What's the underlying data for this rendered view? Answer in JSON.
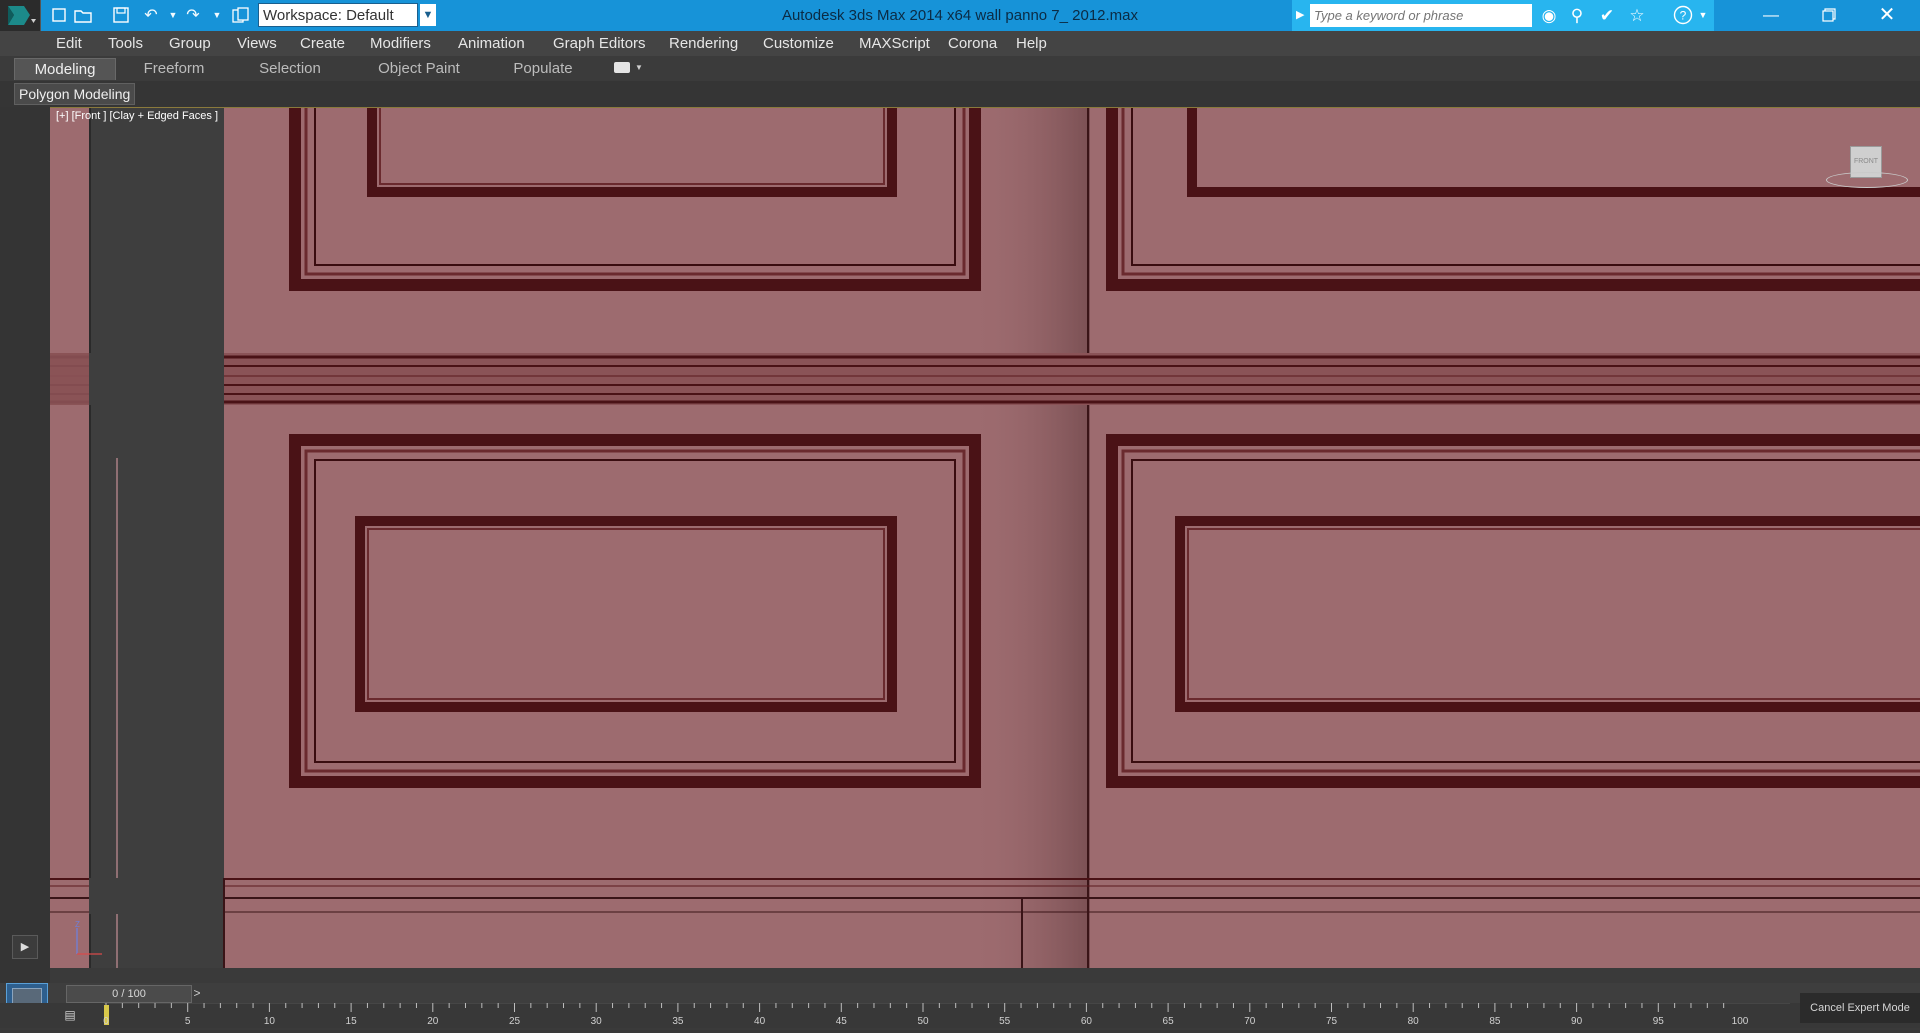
{
  "titlebar": {
    "title": "Autodesk 3ds Max  2014 x64      wall panno 7_ 2012.max",
    "workspace_label": "Workspace: Default",
    "search_placeholder": "Type a keyword or phrase",
    "background": "#1793d8"
  },
  "quick_access_icons": [
    "new-file-icon",
    "open-file-icon",
    "save-file-icon",
    "undo-icon",
    "undo-dropdown-icon",
    "redo-icon",
    "redo-dropdown-icon",
    "project-folder-icon"
  ],
  "search_tools": [
    "binoculars-icon",
    "key-icon",
    "exchange-icon",
    "star-icon",
    "help-icon"
  ],
  "window_controls": [
    "minimize-icon",
    "restore-icon",
    "close-icon"
  ],
  "menu": {
    "items": [
      "Edit",
      "Tools",
      "Group",
      "Views",
      "Create",
      "Modifiers",
      "Animation",
      "Graph Editors",
      "Rendering",
      "Customize",
      "MAXScript",
      "Corona",
      "Help"
    ]
  },
  "ribbon": {
    "tabs": [
      "Modeling",
      "Freeform",
      "Selection",
      "Object Paint",
      "Populate"
    ],
    "active_tab": "Modeling",
    "panel_label": "Polygon Modeling"
  },
  "viewport": {
    "label": "[+] [Front ] [Clay + Edged Faces ]",
    "viewcube_label": "FRONT",
    "axis_label": "Z",
    "surface_color": "#9d6b6f",
    "frame_color": "#4a1216"
  },
  "timeline": {
    "frame_counter": "0 / 100",
    "next_label": ">",
    "ticks": [
      "0",
      "5",
      "10",
      "15",
      "20",
      "25",
      "30",
      "35",
      "40",
      "45",
      "50",
      "55",
      "60",
      "65",
      "70",
      "75",
      "80",
      "85",
      "90",
      "95",
      "100"
    ],
    "expert_mode_label": "Cancel Expert Mode"
  }
}
